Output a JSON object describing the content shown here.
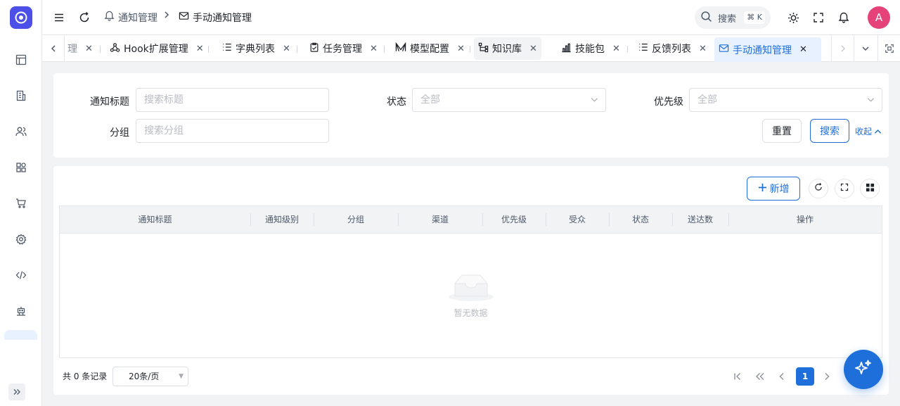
{
  "breadcrumb": {
    "parent": "通知管理",
    "current": "手动通知管理"
  },
  "header": {
    "search_placeholder": "搜索",
    "search_shortcut": "⌘ K",
    "avatar_initial": "A"
  },
  "tabs": [
    {
      "label": "理",
      "icon": "partial"
    },
    {
      "label": "Hook扩展管理",
      "icon": "webhook-icon"
    },
    {
      "label": "字典列表",
      "icon": "list-icon"
    },
    {
      "label": "任务管理",
      "icon": "clipboard-icon"
    },
    {
      "label": "模型配置",
      "icon": "model-icon"
    },
    {
      "label": "知识库",
      "icon": "knowledge-icon"
    },
    {
      "label": "技能包",
      "icon": "bar-chart-icon"
    },
    {
      "label": "反馈列表",
      "icon": "list-icon"
    },
    {
      "label": "手动通知管理",
      "icon": "mail-icon",
      "active": true
    }
  ],
  "filter": {
    "title_label": "通知标题",
    "title_placeholder": "搜索标题",
    "status_label": "状态",
    "status_value": "全部",
    "priority_label": "优先级",
    "priority_value": "全部",
    "group_label": "分组",
    "group_placeholder": "搜索分组",
    "reset_label": "重置",
    "search_label": "搜索",
    "collapse_label": "收起"
  },
  "table": {
    "add_label": "新增",
    "columns": [
      "通知标题",
      "通知级别",
      "分组",
      "渠道",
      "优先级",
      "受众",
      "状态",
      "送达数",
      "操作"
    ],
    "empty_text": "暂无数据"
  },
  "pagination": {
    "total_text": "共 0 条记录",
    "page_size": "20条/页",
    "current_page": "1"
  },
  "colors": {
    "primary": "#1e6fd9",
    "logo": "#4c4fe8",
    "avatar": "#e5427a"
  }
}
